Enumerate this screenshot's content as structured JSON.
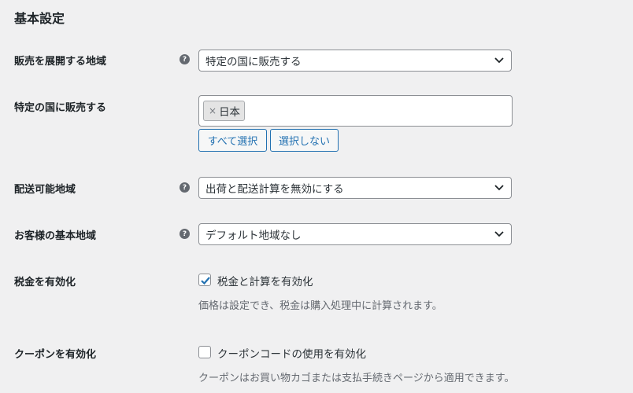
{
  "section_title": "基本設定",
  "rows": {
    "selling_location": {
      "label": "販売を展開する地域",
      "help": "?",
      "value": "特定の国に販売する"
    },
    "specific_countries": {
      "label": "特定の国に販売する",
      "chip_remove": "×",
      "chip_label": "日本",
      "select_all_label": "すべて選択",
      "select_none_label": "選択しない"
    },
    "shipping_location": {
      "label": "配送可能地域",
      "help": "?",
      "value": "出荷と配送計算を無効にする"
    },
    "default_customer_location": {
      "label": "お客様の基本地域",
      "help": "?",
      "value": "デフォルト地域なし"
    },
    "enable_taxes": {
      "label": "税金を有効化",
      "checked": true,
      "checkbox_label": "税金と計算を有効化",
      "description": "価格は設定でき、税金は購入処理中に計算されます。"
    },
    "enable_coupons": {
      "label": "クーポンを有効化",
      "checked": false,
      "checkbox_label": "クーポンコードの使用を有効化",
      "description": "クーポンはお買い物カゴまたは支払手続きページから適用できます。"
    }
  },
  "colors": {
    "background": "#f0f0f1",
    "accent": "#2271b1",
    "text": "#1d2327",
    "muted": "#646970"
  }
}
